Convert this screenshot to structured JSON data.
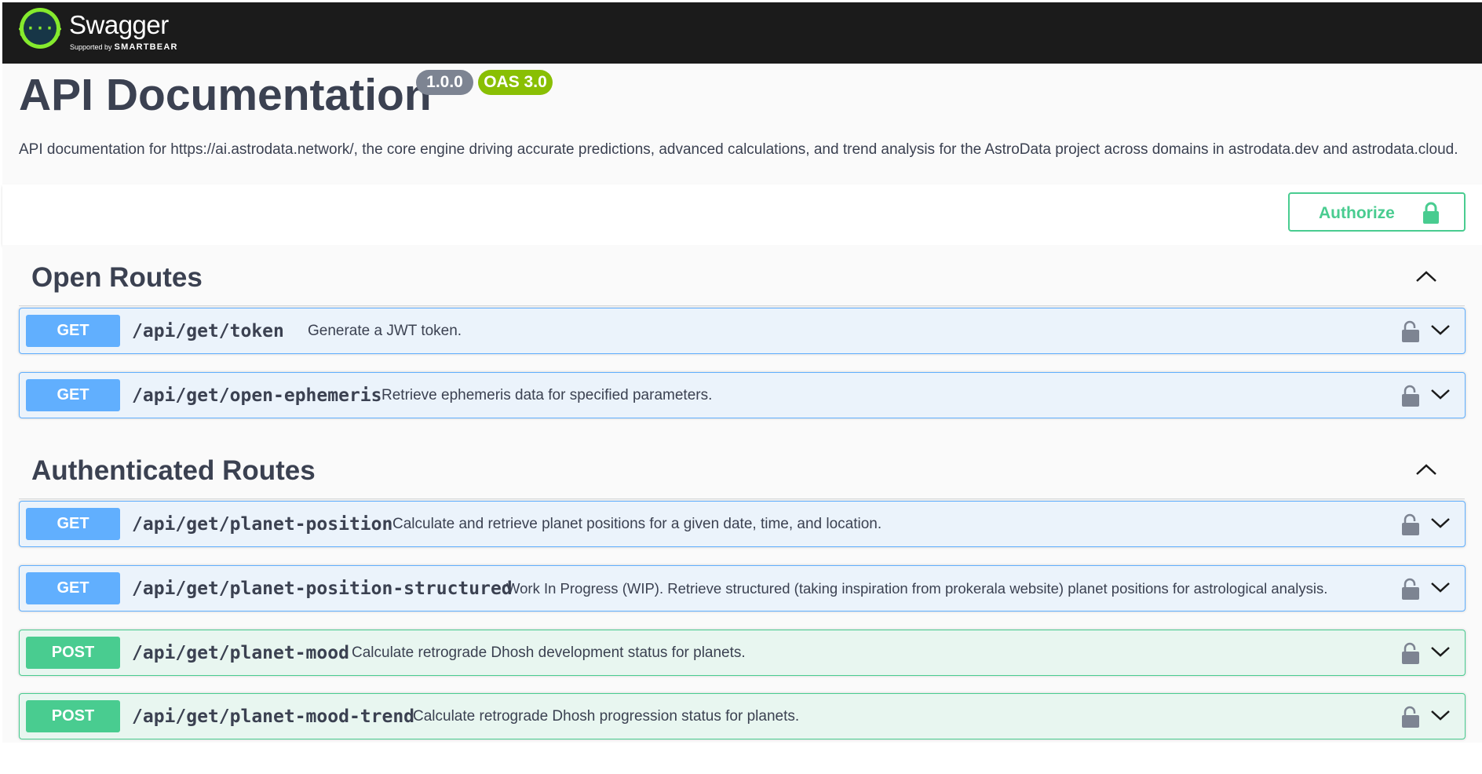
{
  "topbar": {
    "logo_name": "Swagger",
    "supported_by": "Supported by",
    "smartbear": "SMARTBEAR",
    "logo_icon": "swagger-logo-icon"
  },
  "info": {
    "title": "API Documentation",
    "version": "1.0.0",
    "oas": "OAS 3.0",
    "description": "API documentation for https://ai.astrodata.network/, the core engine driving accurate predictions, advanced calculations, and trend analysis for the AstroData project across domains in astrodata.dev and astrodata.cloud."
  },
  "authorize": {
    "label": "Authorize",
    "icon": "lock-closed-icon"
  },
  "sections": [
    {
      "title": "Open Routes",
      "toggle_icon": "chevron-up-icon",
      "operations": [
        {
          "method": "GET",
          "path": "/api/get/token",
          "summary": "Generate a JWT token."
        },
        {
          "method": "GET",
          "path": "/api/get/open-ephemeris",
          "summary": "Retrieve ephemeris data for specified parameters."
        }
      ]
    },
    {
      "title": "Authenticated Routes",
      "toggle_icon": "chevron-up-icon",
      "operations": [
        {
          "method": "GET",
          "path": "/api/get/planet-position",
          "summary": "Calculate and retrieve planet positions for a given date, time, and location."
        },
        {
          "method": "GET",
          "path": "/api/get/planet-position-structured",
          "summary": "Work In Progress (WIP). Retrieve structured (taking inspiration from prokerala website) planet positions for astrological analysis."
        },
        {
          "method": "POST",
          "path": "/api/get/planet-mood",
          "summary": "Calculate retrograde Dhosh development status for planets."
        },
        {
          "method": "POST",
          "path": "/api/get/planet-mood-trend",
          "summary": "Calculate retrograde Dhosh progression status for planets."
        }
      ]
    }
  ],
  "colors": {
    "topbar": "#1b1b1b",
    "get": "#61affe",
    "post": "#49cc90",
    "get_bg": "#ebf3fb",
    "post_bg": "#e8f6f0",
    "version_badge": "#7d8492",
    "oas_badge": "#89bf04",
    "logo_green": "#85ea2d"
  }
}
